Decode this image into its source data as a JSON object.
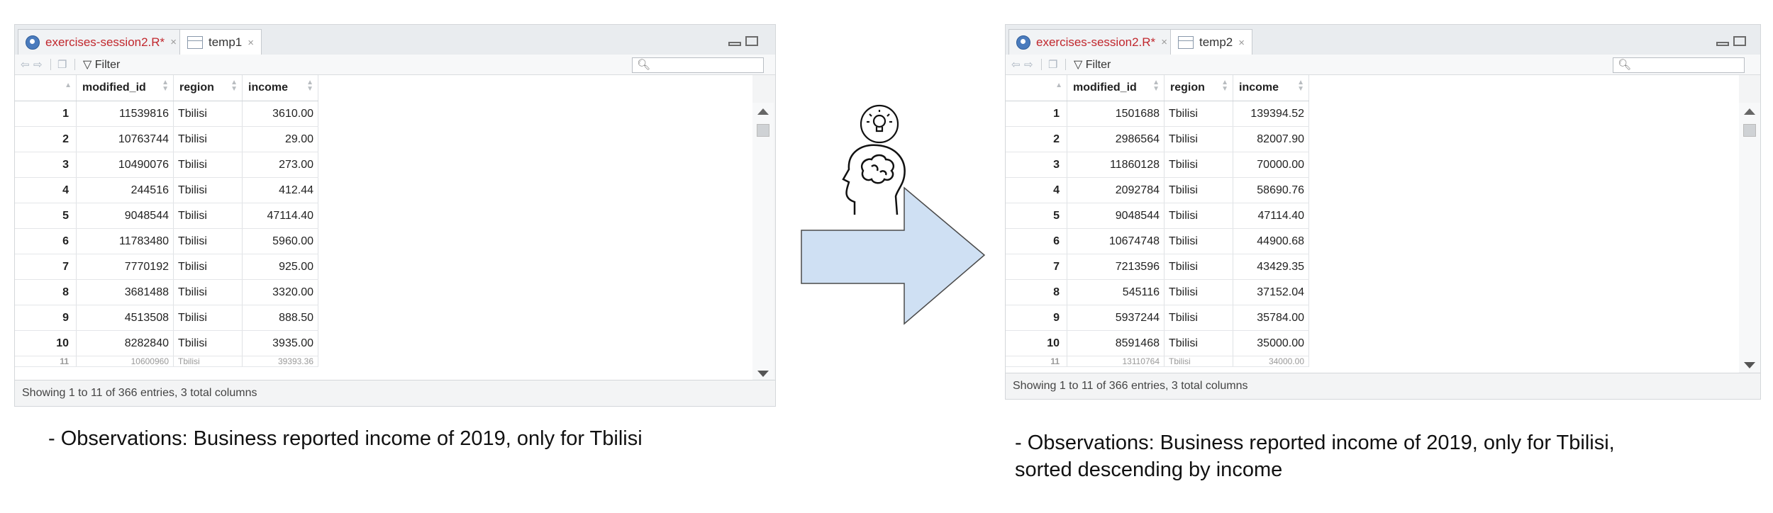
{
  "left": {
    "tabs": [
      {
        "label": "exercises-session2.R*",
        "close": "×"
      },
      {
        "label": "temp1",
        "close": "×"
      }
    ],
    "toolbar": {
      "filter_label": "Filter"
    },
    "columns": [
      "modified_id",
      "region",
      "income"
    ],
    "rows": [
      {
        "n": "1",
        "id": "11539816",
        "region": "Tbilisi",
        "income": "3610.00"
      },
      {
        "n": "2",
        "id": "10763744",
        "region": "Tbilisi",
        "income": "29.00"
      },
      {
        "n": "3",
        "id": "10490076",
        "region": "Tbilisi",
        "income": "273.00"
      },
      {
        "n": "4",
        "id": "244516",
        "region": "Tbilisi",
        "income": "412.44"
      },
      {
        "n": "5",
        "id": "9048544",
        "region": "Tbilisi",
        "income": "47114.40"
      },
      {
        "n": "6",
        "id": "11783480",
        "region": "Tbilisi",
        "income": "5960.00"
      },
      {
        "n": "7",
        "id": "7770192",
        "region": "Tbilisi",
        "income": "925.00"
      },
      {
        "n": "8",
        "id": "3681488",
        "region": "Tbilisi",
        "income": "3320.00"
      },
      {
        "n": "9",
        "id": "4513508",
        "region": "Tbilisi",
        "income": "888.50"
      },
      {
        "n": "10",
        "id": "8282840",
        "region": "Tbilisi",
        "income": "3935.00"
      }
    ],
    "partial_row": {
      "n": "11",
      "id": "10600960",
      "region": "Tbilisi",
      "income": "39393.36"
    },
    "status": "Showing 1 to 11 of 366 entries, 3 total columns"
  },
  "right": {
    "tabs": [
      {
        "label": "exercises-session2.R*",
        "close": "×"
      },
      {
        "label": "temp2",
        "close": "×"
      }
    ],
    "toolbar": {
      "filter_label": "Filter"
    },
    "columns": [
      "modified_id",
      "region",
      "income"
    ],
    "rows": [
      {
        "n": "1",
        "id": "1501688",
        "region": "Tbilisi",
        "income": "139394.52"
      },
      {
        "n": "2",
        "id": "2986564",
        "region": "Tbilisi",
        "income": "82007.90"
      },
      {
        "n": "3",
        "id": "11860128",
        "region": "Tbilisi",
        "income": "70000.00"
      },
      {
        "n": "4",
        "id": "2092784",
        "region": "Tbilisi",
        "income": "58690.76"
      },
      {
        "n": "5",
        "id": "9048544",
        "region": "Tbilisi",
        "income": "47114.40"
      },
      {
        "n": "6",
        "id": "10674748",
        "region": "Tbilisi",
        "income": "44900.68"
      },
      {
        "n": "7",
        "id": "7213596",
        "region": "Tbilisi",
        "income": "43429.35"
      },
      {
        "n": "8",
        "id": "545116",
        "region": "Tbilisi",
        "income": "37152.04"
      },
      {
        "n": "9",
        "id": "5937244",
        "region": "Tbilisi",
        "income": "35784.00"
      },
      {
        "n": "10",
        "id": "8591468",
        "region": "Tbilisi",
        "income": "35000.00"
      }
    ],
    "partial_row": {
      "n": "11",
      "id": "13110764",
      "region": "Tbilisi",
      "income": "34000.00"
    },
    "status": "Showing 1 to 11 of 366 entries, 3 total columns"
  },
  "captions": {
    "left": "- Observations: Business reported income of 2019, only for Tbilisi",
    "right_line1": "- Observations: Business reported income of 2019, only for Tbilisi,",
    "right_line2": "sorted descending by income"
  },
  "colors": {
    "arrow_fill": "#cfe0f3",
    "modified_tab": "#c1272d"
  },
  "icons": [
    "lightbulb-icon",
    "head-brain-icon",
    "search-icon",
    "filter-icon",
    "back-icon",
    "forward-icon",
    "popout-icon"
  ]
}
